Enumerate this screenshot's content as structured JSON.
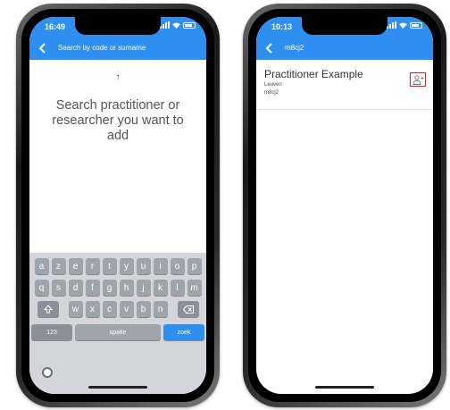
{
  "colors": {
    "accent": "#2e8ff0",
    "highlight_border": "#e02020"
  },
  "left_phone": {
    "status_time": "16:49",
    "appbar": {
      "back_icon": "chevron-left-icon",
      "search_placeholder": "Search by code or surname"
    },
    "empty_hint": {
      "arrow": "↑",
      "message": "Search practitioner or researcher you want to add"
    },
    "keyboard": {
      "row1": [
        "a",
        "z",
        "e",
        "r",
        "t",
        "y",
        "u",
        "i",
        "o",
        "p"
      ],
      "row2": [
        "q",
        "s",
        "d",
        "f",
        "g",
        "h",
        "j",
        "k",
        "l",
        "m"
      ],
      "row3": [
        "w",
        "x",
        "c",
        "v",
        "b",
        "n"
      ],
      "shift_icon": "shift-icon",
      "backspace_icon": "backspace-icon",
      "num_label": "123",
      "space_label": "spatie",
      "go_label": "zoek",
      "emoji_icon": "emoji-icon"
    }
  },
  "right_phone": {
    "status_time": "10:13",
    "appbar": {
      "back_icon": "chevron-left-icon",
      "title": "m8cj2"
    },
    "result": {
      "name": "Practitioner Example",
      "city": "Leuven",
      "code": "m8cj2",
      "action_icon": "add-user-icon"
    }
  }
}
